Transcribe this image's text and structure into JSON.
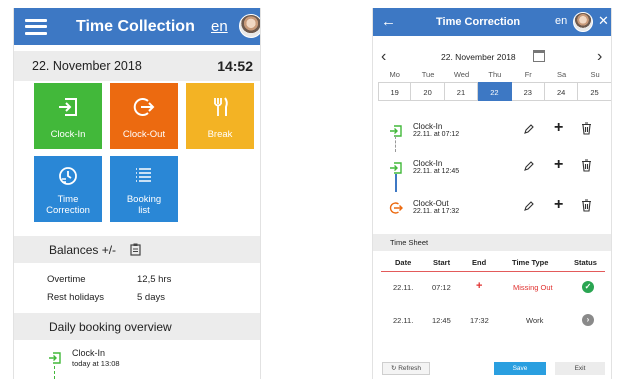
{
  "left": {
    "header": {
      "title": "Time Collection",
      "lang": "en"
    },
    "datebar": {
      "date": "22. November 2018",
      "time": "14:52"
    },
    "tiles": {
      "clock_in": "Clock-In",
      "clock_out": "Clock-Out",
      "break": "Break",
      "time_correction": [
        "Time",
        "Correction"
      ],
      "booking_list": [
        "Booking",
        "list"
      ]
    },
    "balances": {
      "title": "Balances +/-",
      "rows": [
        {
          "label": "Overtime",
          "value": "12,5 hrs"
        },
        {
          "label": "Rest holidays",
          "value": "5 days"
        }
      ]
    },
    "overview": {
      "title": "Daily booking overview",
      "item": {
        "name": "Clock-In",
        "sub": "today at 13:08"
      }
    }
  },
  "right": {
    "header": {
      "back": "←",
      "title": "Time Correction",
      "lang": "en",
      "close": "✕"
    },
    "datebar": {
      "prev": "‹",
      "date": "22. November 2018",
      "next": "›"
    },
    "weekdays": [
      "Mo",
      "Tue",
      "Wed",
      "Thu",
      "Fr",
      "Sa",
      "Su"
    ],
    "days": [
      "19",
      "20",
      "21",
      "22",
      "23",
      "24",
      "25"
    ],
    "selected_day": "22",
    "bookings": [
      {
        "name": "Clock-In",
        "sub": "22.11. at 07:12",
        "kind": "in"
      },
      {
        "name": "Clock-In",
        "sub": "22.11. at 12:45",
        "kind": "in"
      },
      {
        "name": "Clock-Out",
        "sub": "22.11. at 17:32",
        "kind": "out"
      }
    ],
    "plus_label": "+",
    "timesheet": {
      "title": "Time Sheet",
      "headers": [
        "Date",
        "Start",
        "End",
        "Time Type",
        "Status"
      ],
      "rows": [
        {
          "date": "22.11.",
          "start": "07:12",
          "end": "+",
          "type": "Missing Out",
          "status": "ok"
        },
        {
          "date": "22.11.",
          "start": "12:45",
          "end": "17:32",
          "type": "Work",
          "status": "pending"
        }
      ]
    },
    "footer": {
      "refresh": "↻ Refresh",
      "save": "Save",
      "exit": "Exit"
    }
  },
  "colors": {
    "header": "#3d78c4",
    "green": "#42b83a",
    "orange": "#ec6a10",
    "yellow": "#f3b324",
    "blue": "#2a87d6",
    "missing": "#e0312f",
    "status_ok": "#2aa552",
    "status_pending": "#8a8a8a"
  }
}
